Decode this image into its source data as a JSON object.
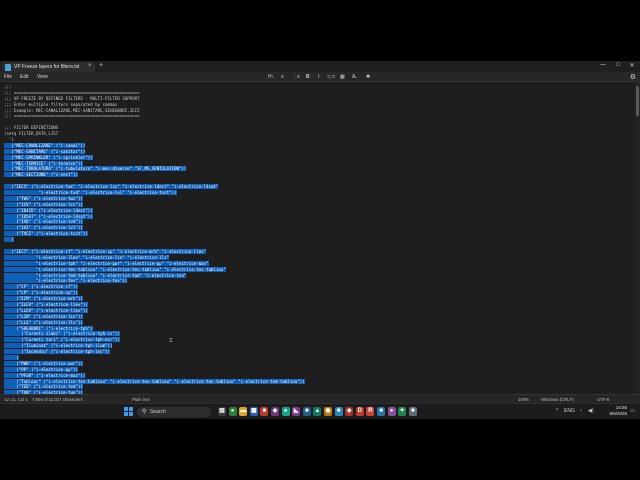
{
  "window": {
    "tab_title": "VP Freeze layers for filters.txt",
    "tab_close": "×",
    "new_tab": "+",
    "controls": {
      "minimize": "—",
      "maximize": "□",
      "close": "✕"
    }
  },
  "menu": {
    "file": "File",
    "edit": "Edit",
    "view": "View"
  },
  "toolbar": {
    "heading": "H↕",
    "bullets": "≡",
    "numbered": "⋮≡",
    "bold": "B",
    "italic": "I",
    "link": "⊂⊃",
    "table": "▦",
    "clear_format": "A̶",
    "copilot": "✺",
    "settings": "⚙"
  },
  "editor": {
    "lines": [
      [
        {
          "text": ";;;",
          "sel": false
        }
      ],
      [
        {
          "text": ";;; ===================================================",
          "sel": false
        }
      ],
      [
        {
          "text": ";;; VP FREEZE BY DEFINED FILTERS - MULTI-FILTER SUPPORT",
          "sel": false
        }
      ],
      [
        {
          "text": ";;; Enter multiple filters separated by commas",
          "sel": false
        }
      ],
      [
        {
          "text": ";;; Example: MEC-CANALIZARE,MEC-SANITARE,SEHEABURI,IEC5",
          "sel": false
        }
      ],
      [
        {
          "text": ";;; ===================================================",
          "sel": false
        }
      ],
      [
        {
          "text": "",
          "sel": false
        }
      ],
      [
        {
          "text": ";;; FILTER DEFINITIONS",
          "sel": false
        }
      ],
      [
        {
          "text": "(setq FILTER_DATA_LIST",
          "sel": false
        }
      ],
      [
        {
          "text": "  '(",
          "sel": false
        }
      ],
      [
        {
          "text": "   (\"MEC-CANALIZARE\" (\"i-canal\"))",
          "sel": true
        }
      ],
      [
        {
          "text": "   (\"MEC-SANITARE\" (\"i-sanitar\"))",
          "sel": true
        }
      ],
      [
        {
          "text": "   (\"MEC-SPRINKLER\" (\"i-sprinkler\"))",
          "sel": true
        }
      ],
      [
        {
          "text": "   (\"MEC-TERMICE\" (\"i-termice\"))",
          "sel": true
        }
      ],
      [
        {
          "text": "   (\"MEC-TUBULATURA\" (\"i-tubulatura\" \"i-mec-diverse\" \"ST_MS_VENTILATION\"))",
          "sel": true
        }
      ],
      [
        {
          "text": "   (\"MEC-SECTIUNE\" (\"i-sect\"))",
          "sel": true
        }
      ],
      [
        {
          "text": "",
          "sel": false
        }
      ],
      [
        {
          "text": "   (\"IEC5\" (\"i-electrice-tws\" \"i-electrice-lcs\" \"i-electrice-l4ect\" \"i-electrice-l4sat\"",
          "sel": true
        }
      ],
      [
        {
          "text": "              \"i-electrice-tvd\" \"i-electrice-lvl\" \"i-electrice-tvct\"))",
          "sel": true
        }
      ],
      [
        {
          "text": "     (\"TWS\" (\"i-electrice-tws\"))",
          "sel": true
        }
      ],
      [
        {
          "text": "     (\"ICV\" (\"i-electrice-lcs\"))",
          "sel": true
        }
      ],
      [
        {
          "text": "     (\"ID4CD\" (\"i-electrice-l4ect\"))",
          "sel": true
        }
      ],
      [
        {
          "text": "     (\"ID5AT\" (\"i-electrice-l4sat\"))",
          "sel": true
        }
      ],
      [
        {
          "text": "     (\"IVD\" (\"i-electrice-tvd\"))",
          "sel": true
        }
      ],
      [
        {
          "text": "     (\"IVI\" (\"i-electrice-lvl\"))",
          "sel": true
        }
      ],
      [
        {
          "text": "     (\"TVCI\" (\"i-electrice-tvct\"))",
          "sel": true
        }
      ],
      [
        {
          "text": "   )",
          "sel": true
        }
      ],
      [
        {
          "text": "",
          "sel": false
        }
      ],
      [
        {
          "text": "   (\"IEC7\" (\"i-electrice-cf\" \"i-electrice-cp\" \"i-electrice-mrh\" \"i-electrice-llev\"",
          "sel": true
        }
      ],
      [
        {
          "text": "             \"i-electrice-llev\" \"i-electrice-lin\" \"i-electrice-lls\"",
          "sel": true
        }
      ],
      [
        {
          "text": "             \"i-electrice-tph\" \"i-electrice-pwr\" \"i-electrice-pp\" \"i-electrice-mav\"",
          "sel": true
        }
      ],
      [
        {
          "text": "             \"i-electrice-tev-tabliou\" \"i-electrice-tev-tabliou\" \"i-electrice-tes-tabliou\"",
          "sel": true
        }
      ],
      [
        {
          "text": "             \"i-electrice-ted-tabliou\" \"i-electrice-tad\" \"i-electrice-tun\"",
          "sel": true
        }
      ],
      [
        {
          "text": "             \"i-electrice-tev\" \"i-electrice-tev\"))",
          "sel": true
        }
      ],
      [
        {
          "text": "     (\"CF\" (\"i-electrice-cf\"))",
          "sel": true
        }
      ],
      [
        {
          "text": "     (\"CP\" (\"i-electrice-cp\"))",
          "sel": true
        }
      ],
      [
        {
          "text": "     (\"ECM\" (\"i-electrice-mrh\"))",
          "sel": true
        }
      ],
      [
        {
          "text": "     (\"ILEV\" (\"i-electrice-llev\"))",
          "sel": true
        }
      ],
      [
        {
          "text": "     (\"LLEV\" (\"i-electrice-llev\"))",
          "sel": true
        }
      ],
      [
        {
          "text": "     (\"LIN\" (\"i-electrice-lin\"))",
          "sel": true
        }
      ],
      [
        {
          "text": "     (\"LLS\" (\"i-electrice-lls\"))",
          "sel": true
        }
      ],
      [
        {
          "text": "     (\"SHEABURI\" (\"i-electrice-tph\")",
          "sel": true
        }
      ],
      [
        {
          "text": "       (\"Curenti slabi\" (\"i-electrice-tph-cs\"))",
          "sel": true
        }
      ],
      [
        {
          "text": "       (\"Curenti tari\" (\"i-electrice-tph-ecr\"))",
          "sel": true
        }
      ],
      [
        {
          "text": "       (\"Iluminat\" (\"i-electrice-tph-ilum\"))",
          "sel": true
        }
      ],
      [
        {
          "text": "       (\"Incendiu\" (\"i-electrice-tph-inc\"))",
          "sel": true
        }
      ],
      [
        {
          "text": "     )",
          "sel": true
        }
      ],
      [
        {
          "text": "     (\"PWR\" (\"i-electrice-pwr\"))",
          "sel": true
        }
      ],
      [
        {
          "text": "     (\"PP\" (\"i-electrice-pp\"))",
          "sel": true
        }
      ],
      [
        {
          "text": "     (\"PFSR\" (\"i-electrice-mav\"))",
          "sel": true
        }
      ],
      [
        {
          "text": "     (\"Tablour\" (\"i-electrice-tev-tabliou\" \"i-electrice-tev-tabliou\" \"i-electrice-tes-tabliou\" \"i-electrice-ted-tabliou\"))",
          "sel": true
        }
      ],
      [
        {
          "text": "     (\"TED\" (\"i-electrice-ted\"))",
          "sel": true
        }
      ],
      [
        {
          "text": "     (\"TUN\" (\"i-electrice-tun\"))",
          "sel": true
        }
      ]
    ]
  },
  "status": {
    "position": "Ln 11, Col 1",
    "characters": "7,804 of 11,027 characters",
    "format": "Plain text",
    "zoom": "100%",
    "line_ending": "Windows (CRLF)",
    "encoding": "UTF-8"
  },
  "taskbar": {
    "search_label": "Search",
    "language": "ENG",
    "time": "14:55",
    "date": "6/6/2026",
    "apps": [
      {
        "name": "files",
        "glyph": "▤",
        "color": "#3a3a3a"
      },
      {
        "name": "chrome",
        "glyph": "●",
        "color": "#2a7d3b"
      },
      {
        "name": "explorer",
        "glyph": "▬",
        "color": "#e0a526"
      },
      {
        "name": "store",
        "glyph": "▦",
        "color": "#2a5db0"
      },
      {
        "name": "app5",
        "glyph": "■",
        "color": "#c0392b"
      },
      {
        "name": "app6",
        "glyph": "◆",
        "color": "#6c3483"
      },
      {
        "name": "app7",
        "glyph": "●",
        "color": "#17a589"
      },
      {
        "name": "visual-studio",
        "glyph": "◣",
        "color": "#7d3c98"
      },
      {
        "name": "app9",
        "glyph": "■",
        "color": "#1f618d"
      },
      {
        "name": "app10",
        "glyph": "▲",
        "color": "#117a65"
      },
      {
        "name": "app11",
        "glyph": "◉",
        "color": "#b9770e"
      },
      {
        "name": "app12",
        "glyph": "■",
        "color": "#2e86c1"
      },
      {
        "name": "app13",
        "glyph": "◆",
        "color": "#a93226"
      },
      {
        "name": "app14",
        "glyph": "D",
        "color": "#c0392b"
      },
      {
        "name": "app15",
        "glyph": "R",
        "color": "#cb4335"
      },
      {
        "name": "app16",
        "glyph": "■",
        "color": "#2874a6"
      },
      {
        "name": "app17",
        "glyph": "●",
        "color": "#884ea0"
      },
      {
        "name": "app18",
        "glyph": "✦",
        "color": "#1e8449"
      },
      {
        "name": "app19",
        "glyph": "■",
        "color": "#5d6d7e"
      }
    ]
  },
  "colors": {
    "selection": "#0e5fb8",
    "editor_bg": "#1e1e1e",
    "accent": "#3b9cf2"
  }
}
